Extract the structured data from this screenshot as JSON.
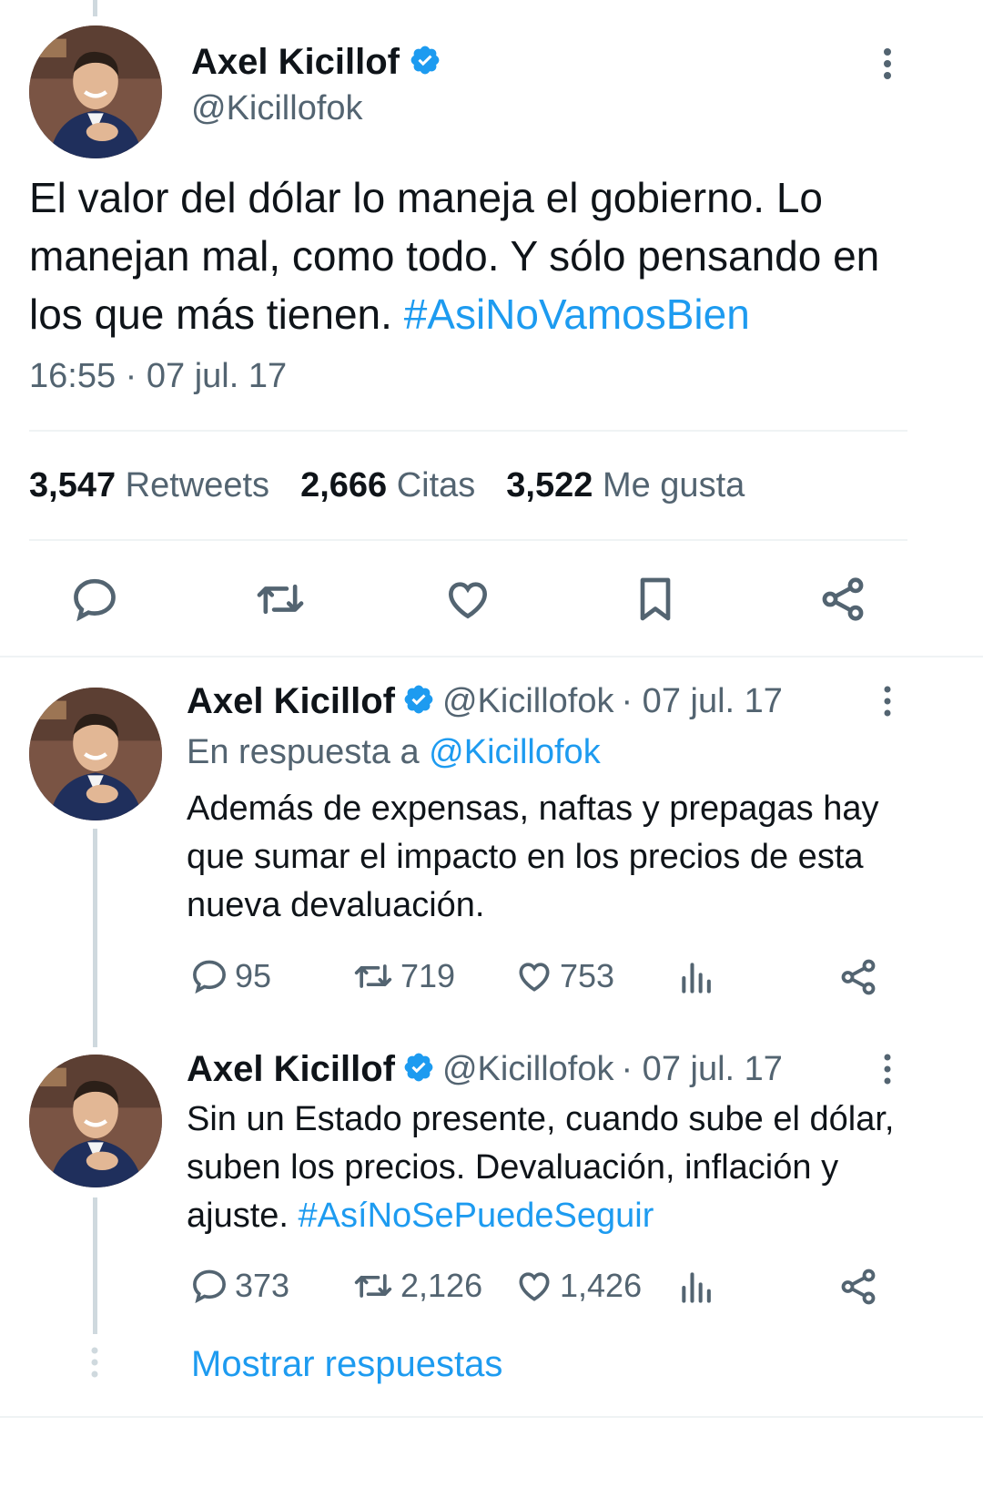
{
  "main_tweet": {
    "name": "Axel Kicillof",
    "handle": "@Kicillofok",
    "text_parts": [
      "El valor del dólar lo maneja el gobierno. Lo manejan mal, como todo. Y sólo pensando en los que más tienen. "
    ],
    "hashtag": "#AsiNoVamosBien",
    "timestamp": "16:55 · 07 jul. 17",
    "stats": {
      "retweets_count": "3,547",
      "retweets_label": "Retweets",
      "quotes_count": "2,666",
      "quotes_label": "Citas",
      "likes_count": "3,522",
      "likes_label": "Me gusta"
    }
  },
  "reply1": {
    "name": "Axel Kicillof",
    "handle": "@Kicillofok",
    "date": "· 07 jul. 17",
    "reply_prefix": "En respuesta a",
    "reply_handle": "@Kicillofok",
    "text": "Además de expensas, naftas y prepagas hay que sumar el impacto en los precios de esta nueva devaluación.",
    "replies": "95",
    "retweets": "719",
    "likes": "753"
  },
  "reply2": {
    "name": "Axel Kicillof",
    "handle": "@Kicillofok",
    "date": "· 07 jul. 17",
    "text": "Sin un Estado presente, cuando sube el dólar, suben los precios. Devaluación, inflación y ajuste. ",
    "hashtag": "#AsíNoSePuedeSeguir",
    "replies": "373",
    "retweets": "2,126",
    "likes": "1,426"
  },
  "show_replies": "Mostrar respuestas",
  "colors": {
    "accent": "#1d9bf0",
    "text": "#0f1419",
    "muted": "#536471",
    "divider": "#eff3f4"
  }
}
